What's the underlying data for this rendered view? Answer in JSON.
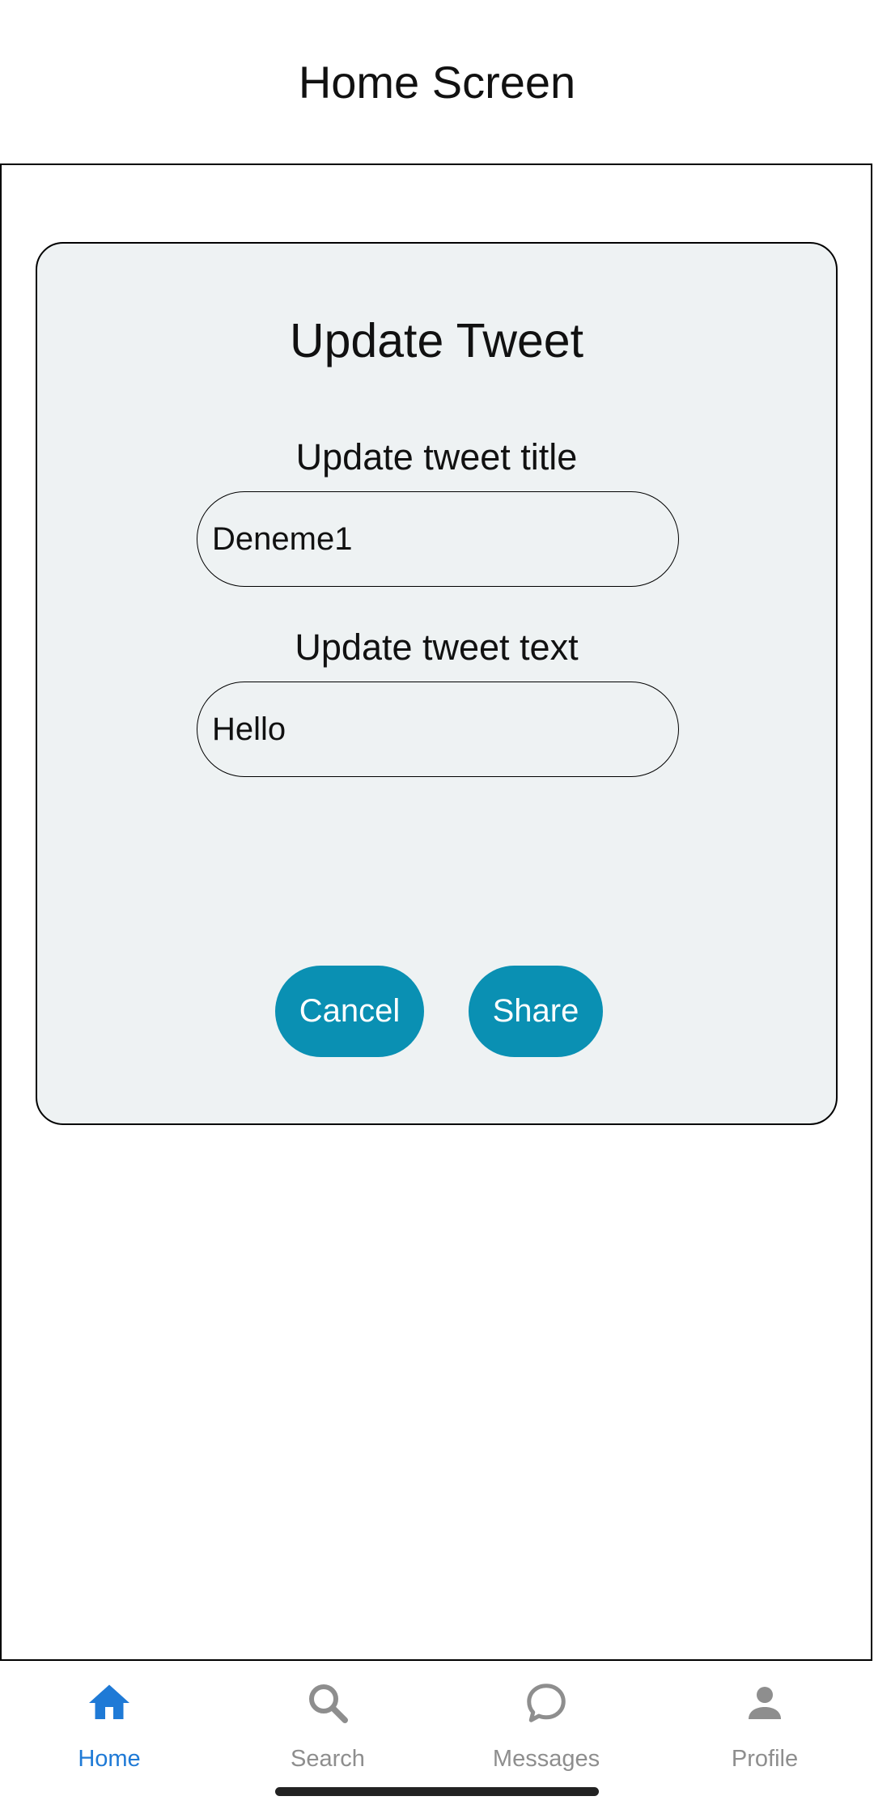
{
  "header": {
    "title": "Home Screen"
  },
  "dialog": {
    "title": "Update Tweet",
    "title_field": {
      "label": "Update tweet title",
      "value": "Deneme1"
    },
    "text_field": {
      "label": "Update tweet text",
      "value": "Hello"
    },
    "cancel_label": "Cancel",
    "share_label": "Share",
    "button_color": "#0a90b3",
    "card_background": "#eef2f3"
  },
  "tabbar": {
    "active_color": "#1f7ad6",
    "inactive_color": "#8e8e8e",
    "tabs": [
      {
        "label": "Home",
        "icon": "home-icon",
        "active": true
      },
      {
        "label": "Search",
        "icon": "search-icon",
        "active": false
      },
      {
        "label": "Messages",
        "icon": "chat-bubble-icon",
        "active": false
      },
      {
        "label": "Profile",
        "icon": "person-icon",
        "active": false
      }
    ]
  }
}
